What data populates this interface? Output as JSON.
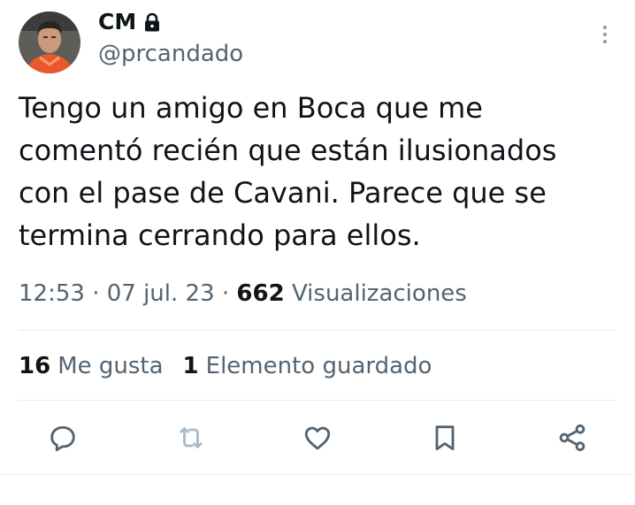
{
  "author": {
    "display_name": "CM",
    "handle": "@prcandado",
    "protected_icon": "lock-icon"
  },
  "tweet": {
    "text": "Tengo un amigo en Boca que me\ncomentó recién que están ilusionados\ncon el pase de Cavani. Parece que se\ntermina cerrando para ellos."
  },
  "meta": {
    "time": "12:53",
    "sep1": " · ",
    "date": "07 jul. 23",
    "sep2": " · ",
    "views_count": "662",
    "views_label": "Visualizaciones"
  },
  "stats": {
    "likes_count": "16",
    "likes_label": "Me gusta",
    "bookmarks_count": "1",
    "bookmarks_label": "Elemento guardado"
  },
  "actions": [
    {
      "icon": "reply-icon"
    },
    {
      "icon": "retweet-icon"
    },
    {
      "icon": "like-icon"
    },
    {
      "icon": "bookmark-icon"
    },
    {
      "icon": "share-icon"
    }
  ],
  "colors": {
    "text_primary": "#0f1419",
    "text_secondary": "#536471",
    "divider": "#e6ecf0",
    "disabled_icon": "#a9bbc9"
  }
}
